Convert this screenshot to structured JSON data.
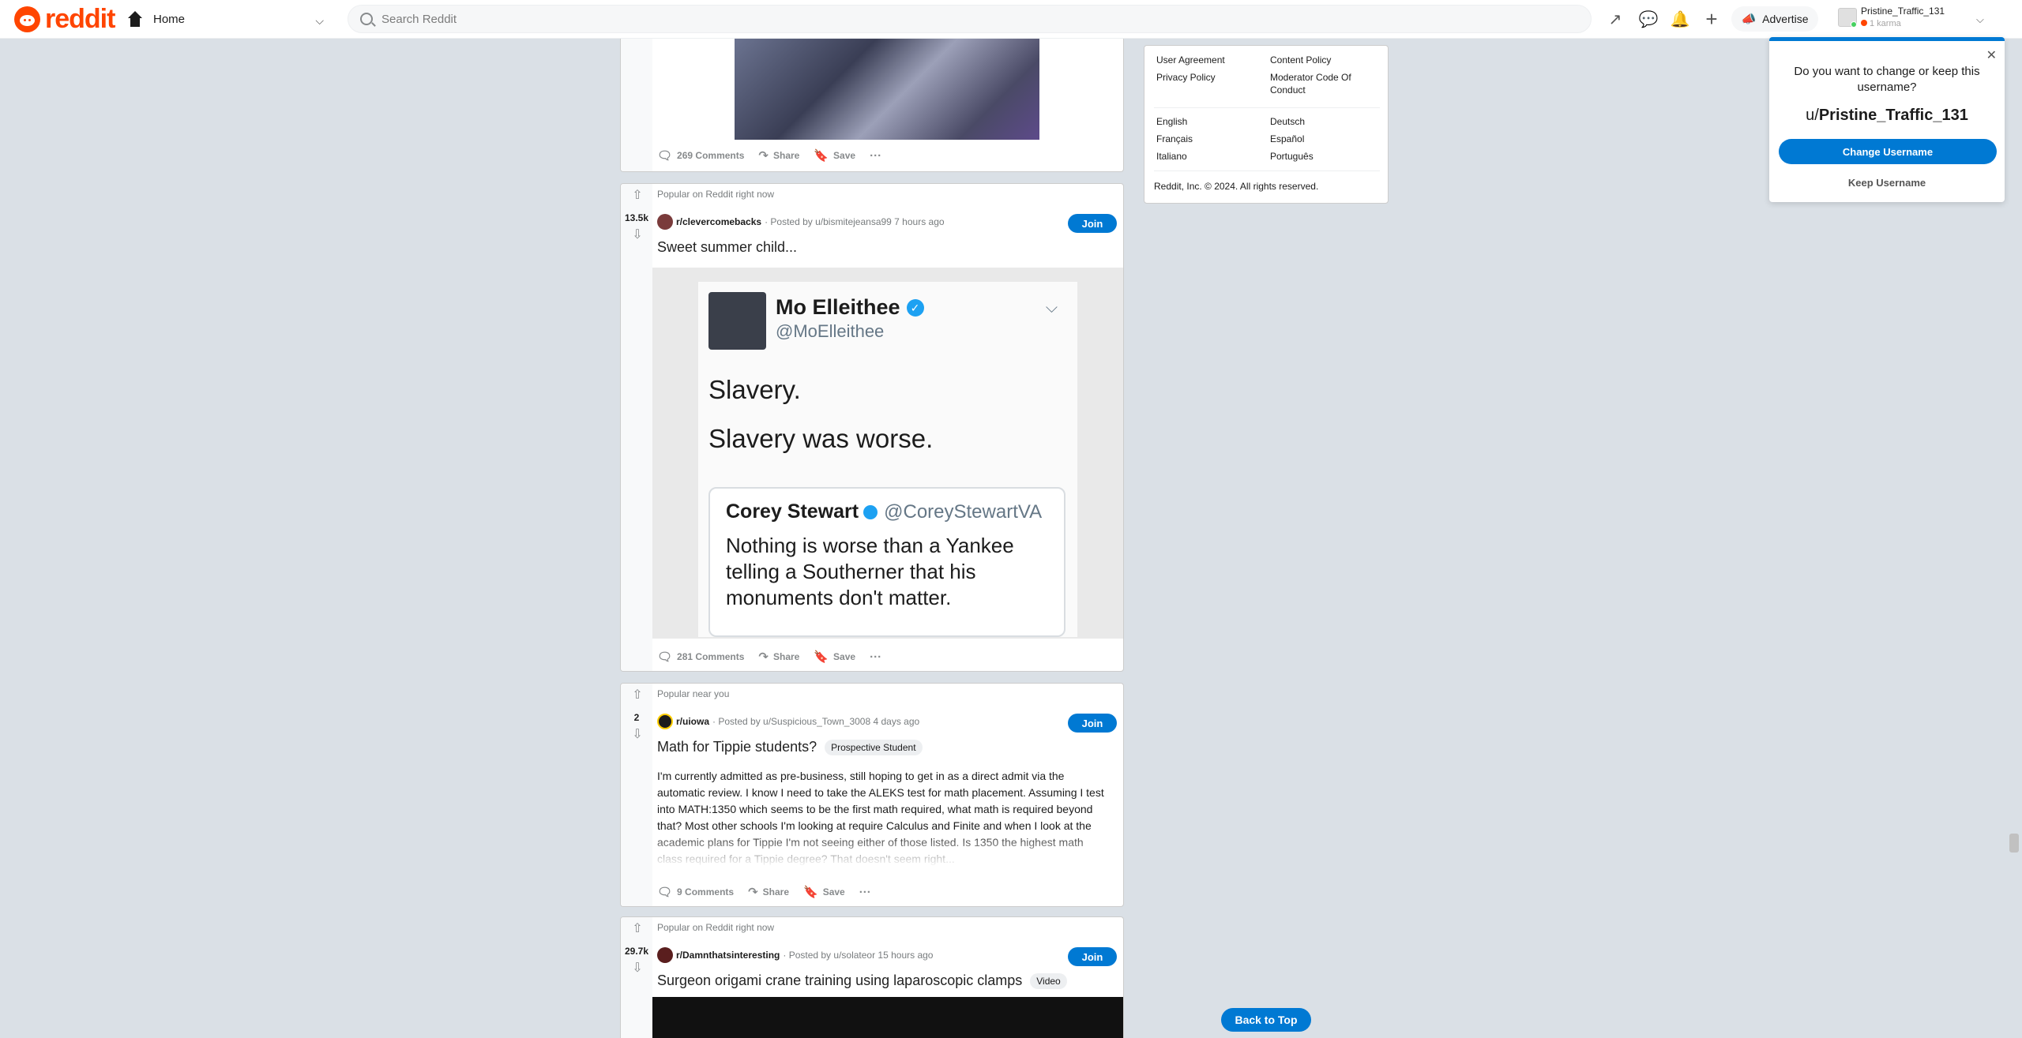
{
  "header": {
    "logo": "reddit",
    "home_label": "Home",
    "search_placeholder": "Search Reddit",
    "advertise_label": "Advertise",
    "username": "Pristine_Traffic_131",
    "karma": "1 karma"
  },
  "post1": {
    "comments": "269 Comments",
    "share": "Share",
    "save": "Save"
  },
  "post2": {
    "label": "Popular on Reddit right now",
    "score": "13.5k",
    "subreddit": "r/clevercomebacks",
    "posted_by": "· Posted by u/bismitejeansa99 7 hours ago",
    "join": "Join",
    "title": "Sweet summer child...",
    "tweet": {
      "name": "Mo Elleithee",
      "handle": "@MoElleithee",
      "line1": "Slavery.",
      "line2": "Slavery was worse.",
      "quote_name": "Corey Stewart",
      "quote_handle": "@CoreyStewartVA",
      "quote_text": "Nothing is worse than a Yankee telling a Southerner that his monuments don't matter."
    },
    "comments": "281 Comments",
    "share": "Share",
    "save": "Save"
  },
  "post3": {
    "label": "Popular near you",
    "score": "2",
    "subreddit": "r/uiowa",
    "posted_by": "· Posted by u/Suspicious_Town_3008 4 days ago",
    "join": "Join",
    "title": "Math for Tippie students?",
    "flair": "Prospective Student",
    "body": "I'm currently admitted as pre-business, still hoping to get in as a direct admit via the automatic review. I know I need to take the ALEKS test for math placement. Assuming I test into MATH:1350 which seems to be the first math required, what math is required beyond that? Most other schools I'm looking at require Calculus and Finite and when I look at the academic plans for Tippie I'm not seeing either of those listed. Is 1350 the highest math class required for a Tippie degree? That doesn't seem right...",
    "comments": "9 Comments",
    "share": "Share",
    "save": "Save"
  },
  "post4": {
    "label": "Popular on Reddit right now",
    "score": "29.7k",
    "subreddit": "r/Damnthatsinteresting",
    "posted_by": "· Posted by u/solateor 15 hours ago",
    "join": "Join",
    "title": "Surgeon origami crane training using laparoscopic clamps",
    "flair": "Video"
  },
  "sidebar": {
    "links_left": [
      "User Agreement",
      "Privacy Policy"
    ],
    "links_right": [
      "Content Policy",
      "Moderator Code Of Conduct"
    ],
    "langs_left": [
      "English",
      "Français",
      "Italiano"
    ],
    "langs_right": [
      "Deutsch",
      "Español",
      "Português"
    ],
    "copyright": "Reddit, Inc. © 2024. All rights reserved."
  },
  "back_to_top": "Back to Top",
  "popup": {
    "question": "Do you want to change or keep this username?",
    "prefix": "u/",
    "username": "Pristine_Traffic_131",
    "change": "Change Username",
    "keep": "Keep Username"
  },
  "colors": {
    "brand": "#ff4500",
    "accent": "#0079d3",
    "background": "#dae0e6"
  }
}
